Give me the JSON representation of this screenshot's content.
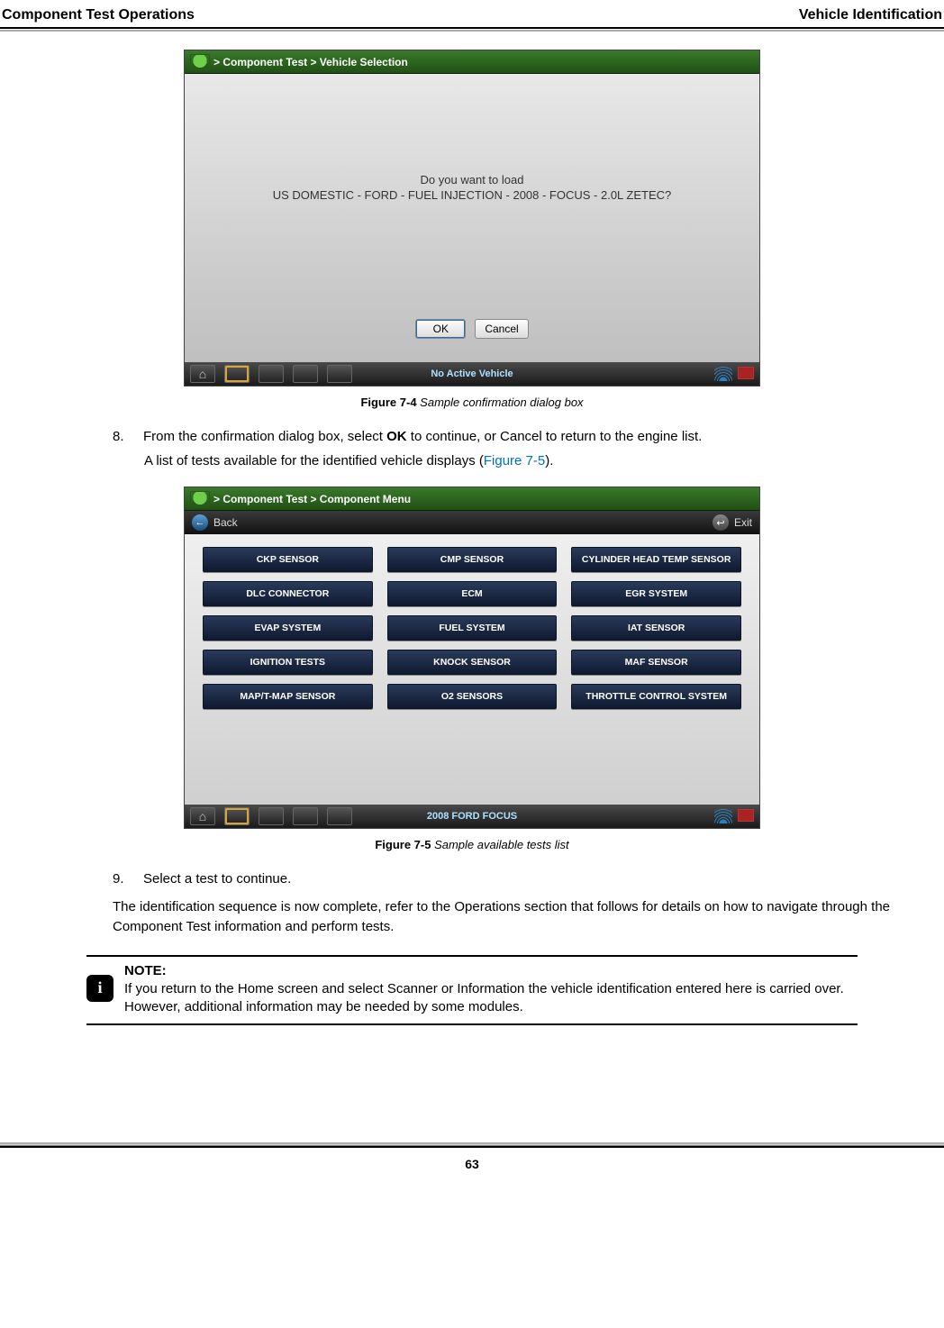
{
  "header": {
    "left": "Component Test Operations",
    "right": "Vehicle Identification"
  },
  "figure1": {
    "breadcrumb": "> Component Test   > Vehicle Selection",
    "prompt_line1": "Do you want to load",
    "prompt_line2": "US DOMESTIC - FORD - FUEL INJECTION - 2008 - FOCUS - 2.0L ZETEC?",
    "ok_label": "OK",
    "cancel_label": "Cancel",
    "status": "No Active Vehicle",
    "caption_bold": "Figure 7-4",
    "caption_italic": " Sample confirmation dialog box"
  },
  "step8": {
    "num": "8.",
    "text_before_bold": "From the confirmation dialog box, select ",
    "bold": "OK",
    "text_after_bold": " to continue, or Cancel to return to the engine list.",
    "continuation_before_link": "A list of tests available for the identified vehicle displays (",
    "link": "Figure 7-5",
    "continuation_after_link": ")."
  },
  "figure2": {
    "breadcrumb": "> Component Test   > Component Menu",
    "back_label": "Back",
    "exit_label": "Exit",
    "menu": [
      "CKP SENSOR",
      "CMP SENSOR",
      "CYLINDER HEAD TEMP SENSOR",
      "DLC CONNECTOR",
      "ECM",
      "EGR SYSTEM",
      "EVAP SYSTEM",
      "FUEL SYSTEM",
      "IAT SENSOR",
      "IGNITION TESTS",
      "KNOCK SENSOR",
      "MAF SENSOR",
      "MAP/T-MAP SENSOR",
      "O2 SENSORS",
      "THROTTLE CONTROL SYSTEM"
    ],
    "status": "2008 FORD FOCUS",
    "caption_bold": "Figure 7-5",
    "caption_italic": " Sample available tests list"
  },
  "step9": {
    "num": "9.",
    "text": "Select a test to continue."
  },
  "para": "The identification sequence is now complete, refer to the Operations section that follows for details on how to navigate through the Component Test information and perform tests.",
  "note": {
    "label": "NOTE:",
    "body": "If you return to the Home screen and select Scanner or Information the vehicle identification entered here is carried over. However, additional information may be needed by some modules."
  },
  "page_number": "63"
}
